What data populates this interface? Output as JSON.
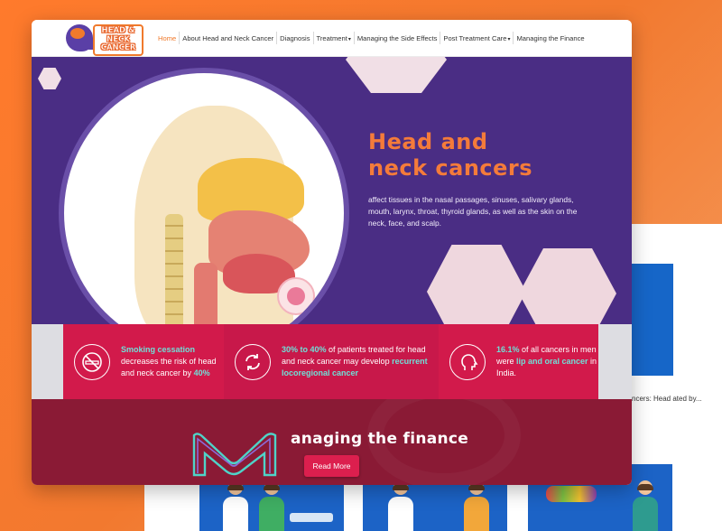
{
  "logo": {
    "text": "HEAD & NECK CANCER"
  },
  "nav": {
    "items": [
      {
        "label": "Home",
        "active": true
      },
      {
        "label": "About Head and Neck Cancer"
      },
      {
        "label": "Diagnosis"
      },
      {
        "label": "Treatment",
        "dropdown": true
      },
      {
        "label": "Managing the Side Effects"
      },
      {
        "label": "Post Treatment Care",
        "dropdown": true
      },
      {
        "label": "Managing the Finance"
      }
    ]
  },
  "hero": {
    "title_line1": "Head and",
    "title_line2": "neck cancers",
    "description": "affect tissues in the nasal passages, sinuses, salivary glands, mouth, larynx, throat, thyroid glands, as well as the skin on the neck, face, and scalp."
  },
  "stats": [
    {
      "icon": "no-smoking-icon",
      "highlight1": "Smoking cessation",
      "text1": " decreases the risk of head and neck cancer by ",
      "highlight2": "40%",
      "text2": ""
    },
    {
      "icon": "recurrence-icon",
      "highlight1": "30% to 40%",
      "text1": " of patients treated for head and neck cancer may develop ",
      "highlight2": "recurrent locoregional cancer",
      "text2": ""
    },
    {
      "icon": "head-profile-icon",
      "highlight1": "16.1%",
      "text1": " of all cancers in men were ",
      "highlight2": "lip and oral cancer",
      "text2": " in India."
    }
  ],
  "finance": {
    "title": "anaging the finance",
    "button": "Read More"
  },
  "background": {
    "side_text": "ncers: Head ated by..."
  },
  "colors": {
    "orange": "#f47b3a",
    "purple": "#4a2d84",
    "crimson": "#d21a4b",
    "teal": "#6fe0d8",
    "maroon": "#8a1a35",
    "blue": "#1c63c6"
  }
}
